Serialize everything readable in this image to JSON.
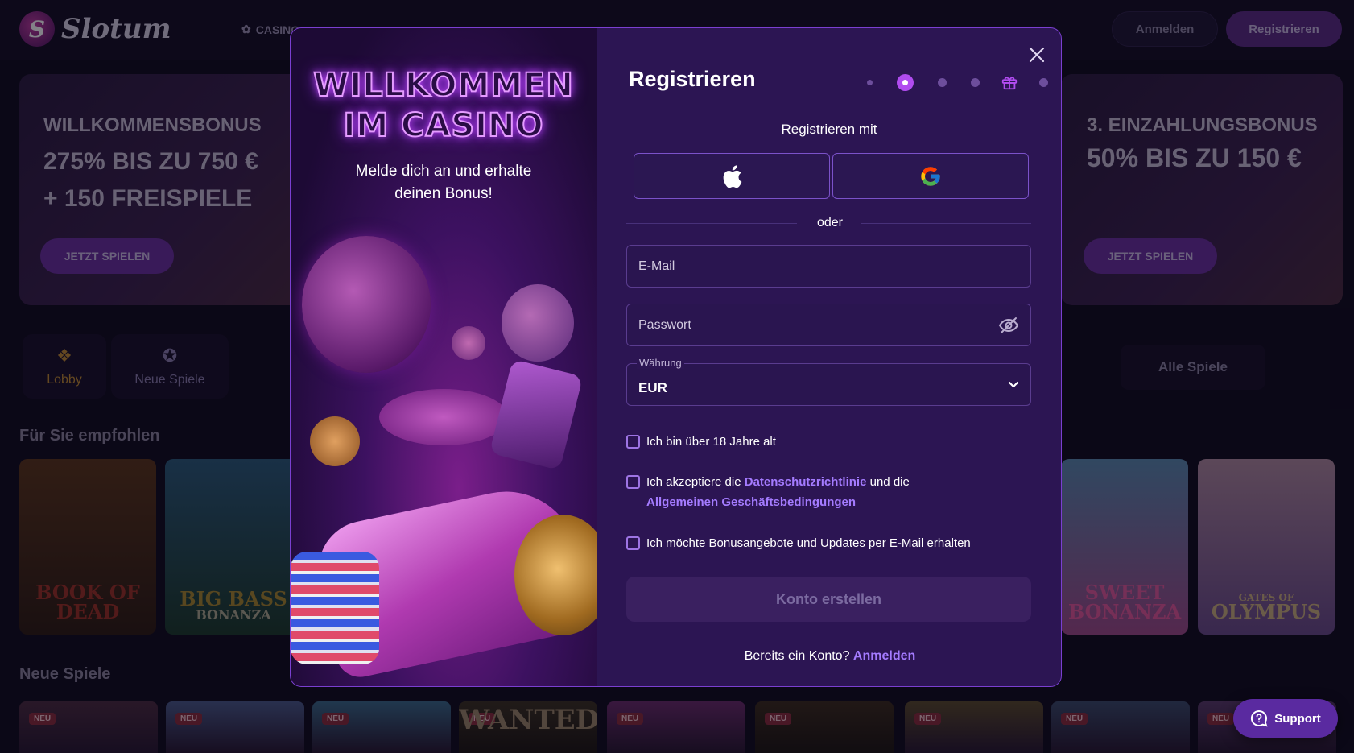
{
  "header": {
    "logo_text": "Slotum",
    "logo_letter": "S",
    "nav_casino": "CASINO",
    "login_label": "Anmelden",
    "register_label": "Registrieren"
  },
  "banners": {
    "left": {
      "line1": "WILLKOMMENSBONUS",
      "line2": "275% BIS ZU 750 €",
      "line3": "+ 150 FREISPIELE",
      "button": "JETZT SPIELEN"
    },
    "right": {
      "line1": "3. EINZAHLUNGSBONUS",
      "line2": "50% BIS ZU 150 €",
      "button": "JETZT SPIELEN"
    }
  },
  "categories": {
    "lobby": "Lobby",
    "new_games": "Neue Spiele",
    "all_games": "Alle Spiele"
  },
  "sections": {
    "recommended": "Für Sie empfohlen",
    "new_games": "Neue Spiele"
  },
  "games": {
    "book_of_dead": "BOOK OF DEAD",
    "big_bass": "BIG BASS",
    "big_bass_sub": "BONANZA",
    "sweet_bonanza_1": "SWEET",
    "sweet_bonanza_2": "BONANZA",
    "gates_of_olympus_small": "GATES OF",
    "gates_of_olympus": "OLYMPUS",
    "wanted": "WANTED",
    "new_badge": "NEU"
  },
  "support_label": "Support",
  "modal": {
    "welcome_line1": "WILLKOMMEN",
    "welcome_line2": "IM CASINO",
    "welcome_sub_line1": "Melde dich an und erhalte",
    "welcome_sub_line2": "deinen Bonus!",
    "title": "Registrieren",
    "register_with": "Registrieren mit",
    "or": "oder",
    "email_placeholder": "E-Mail",
    "password_placeholder": "Passwort",
    "currency_label": "Währung",
    "currency_value": "EUR",
    "check_age": "Ich bin über 18 Jahre alt",
    "check_terms_pre": "Ich akzeptiere die ",
    "check_terms_link1": "Datenschutzrichtlinie",
    "check_terms_mid": " und die",
    "check_terms_link2": "Allgemeinen Geschäftsbedingungen",
    "check_bonus": "Ich möchte Bonusangebote und Updates per E-Mail erhalten",
    "create_button": "Konto erstellen",
    "existing_account": "Bereits ein Konto? ",
    "login_link": "Anmelden",
    "active_step": 2,
    "accent_color": "#b14cf0"
  }
}
